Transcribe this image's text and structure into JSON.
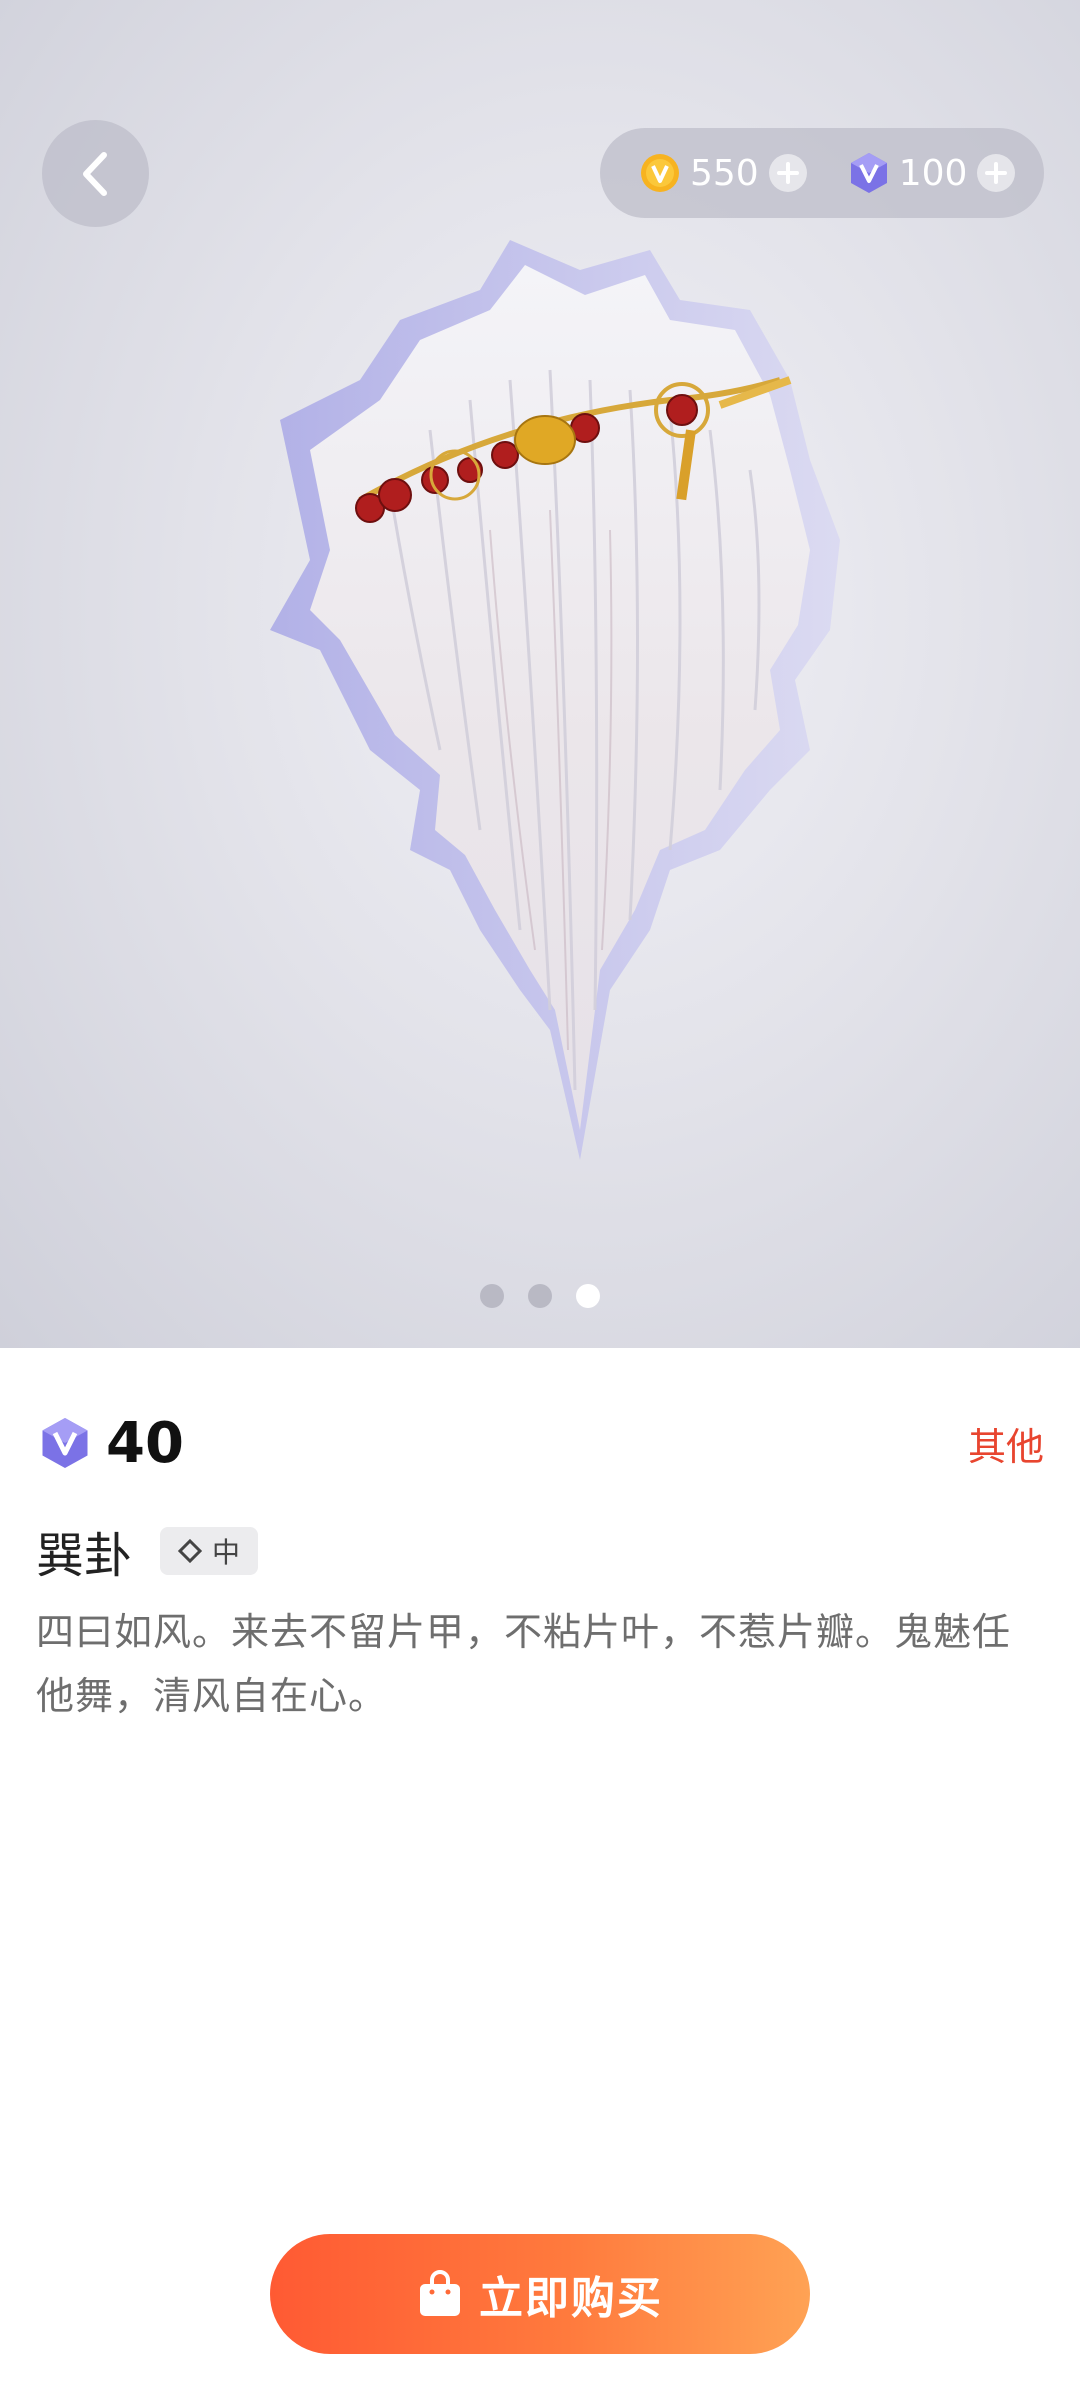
{
  "topbar": {
    "back_icon": "chevron-left-icon",
    "coins": {
      "icon": "gold-coin-icon",
      "value": "550"
    },
    "gems": {
      "icon": "purple-gem-icon",
      "value": "100"
    }
  },
  "preview": {
    "image": "white-hair-with-red-bead-headband",
    "dots_count": 3,
    "active_dot": 3
  },
  "item": {
    "price_icon": "purple-gem-icon",
    "price": "40",
    "category": "其他",
    "name": "巽卦",
    "rarity_icon": "diamond-outline-icon",
    "rarity": "中",
    "description": "四曰如风。来去不留片甲，不粘片叶，不惹片瓣。鬼魅任他舞，清风自在心。"
  },
  "buy_button": {
    "icon": "shopping-bag-icon",
    "label": "立即购买"
  },
  "colors": {
    "accent_red": "#e8452f",
    "button_gradient_start": "#ff5a33",
    "button_gradient_end": "#ffa254"
  }
}
